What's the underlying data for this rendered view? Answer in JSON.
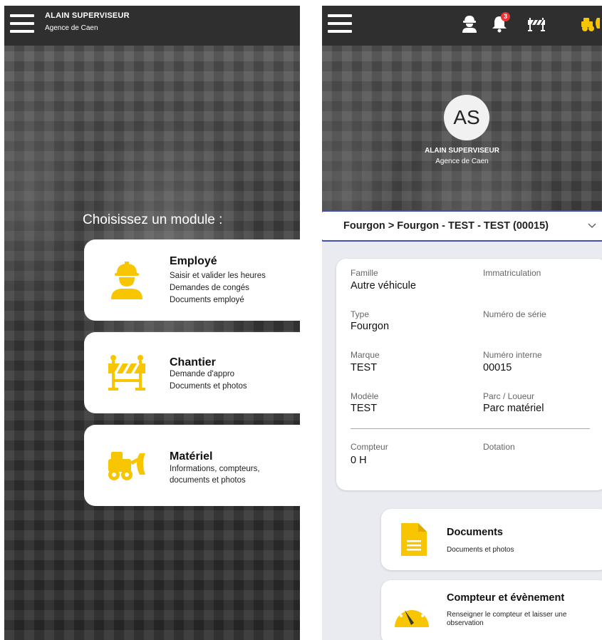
{
  "left_screen": {
    "header": {
      "user_name": "ALAIN SUPERVISEUR",
      "agency": "Agence de Caen"
    },
    "heading": "Choisissez un module :",
    "modules": [
      {
        "title": "Employé",
        "lines": [
          "Saisir et valider les heures",
          "Demandes de congés",
          "Documents employé"
        ],
        "icon": "worker-icon"
      },
      {
        "title": "Chantier",
        "lines": [
          "Demande d'appro",
          "Documents et photos"
        ],
        "icon": "barrier-icon"
      },
      {
        "title": "Matériel",
        "lines": [
          "Informations, compteurs,",
          "documents et photos"
        ],
        "icon": "loader-icon"
      }
    ]
  },
  "right_screen": {
    "topbar": {
      "notification_count": "3",
      "icons": [
        "worker-icon",
        "bell-icon",
        "barrier-icon",
        "loader-icon"
      ]
    },
    "profile": {
      "initials": "AS",
      "name": "ALAIN SUPERVISEUR",
      "agency": "Agence de Caen"
    },
    "vehicle_select": {
      "value": "Fourgon > Fourgon - TEST - TEST (00015)"
    },
    "fields": {
      "famille": {
        "label": "Famille",
        "value": "Autre véhicule"
      },
      "immatriculation": {
        "label": "Immatriculation",
        "value": ""
      },
      "type": {
        "label": "Type",
        "value": "Fourgon"
      },
      "numero_serie": {
        "label": "Numéro de série",
        "value": ""
      },
      "marque": {
        "label": "Marque",
        "value": "TEST"
      },
      "numero_interne": {
        "label": "Numéro interne",
        "value": "00015"
      },
      "modele": {
        "label": "Modèle",
        "value": "TEST"
      },
      "parc_loueur": {
        "label": "Parc / Loueur",
        "value": "Parc matériel"
      },
      "compteur": {
        "label": "Compteur",
        "value": "0 H"
      },
      "dotation": {
        "label": "Dotation",
        "value": ""
      }
    },
    "actions": [
      {
        "title": "Documents",
        "subtitle": "Documents et photos",
        "icon": "document-icon"
      },
      {
        "title": "Compteur et évènement",
        "subtitle": "Renseigner le compteur et laisser une observation",
        "icon": "gauge-icon"
      }
    ]
  },
  "colors": {
    "accent_yellow": "#f7c600",
    "dark_header": "#2f2f2f",
    "select_border": "#3f51b5",
    "badge_red": "#e33333",
    "panel_bg": "#e9ebf0"
  }
}
